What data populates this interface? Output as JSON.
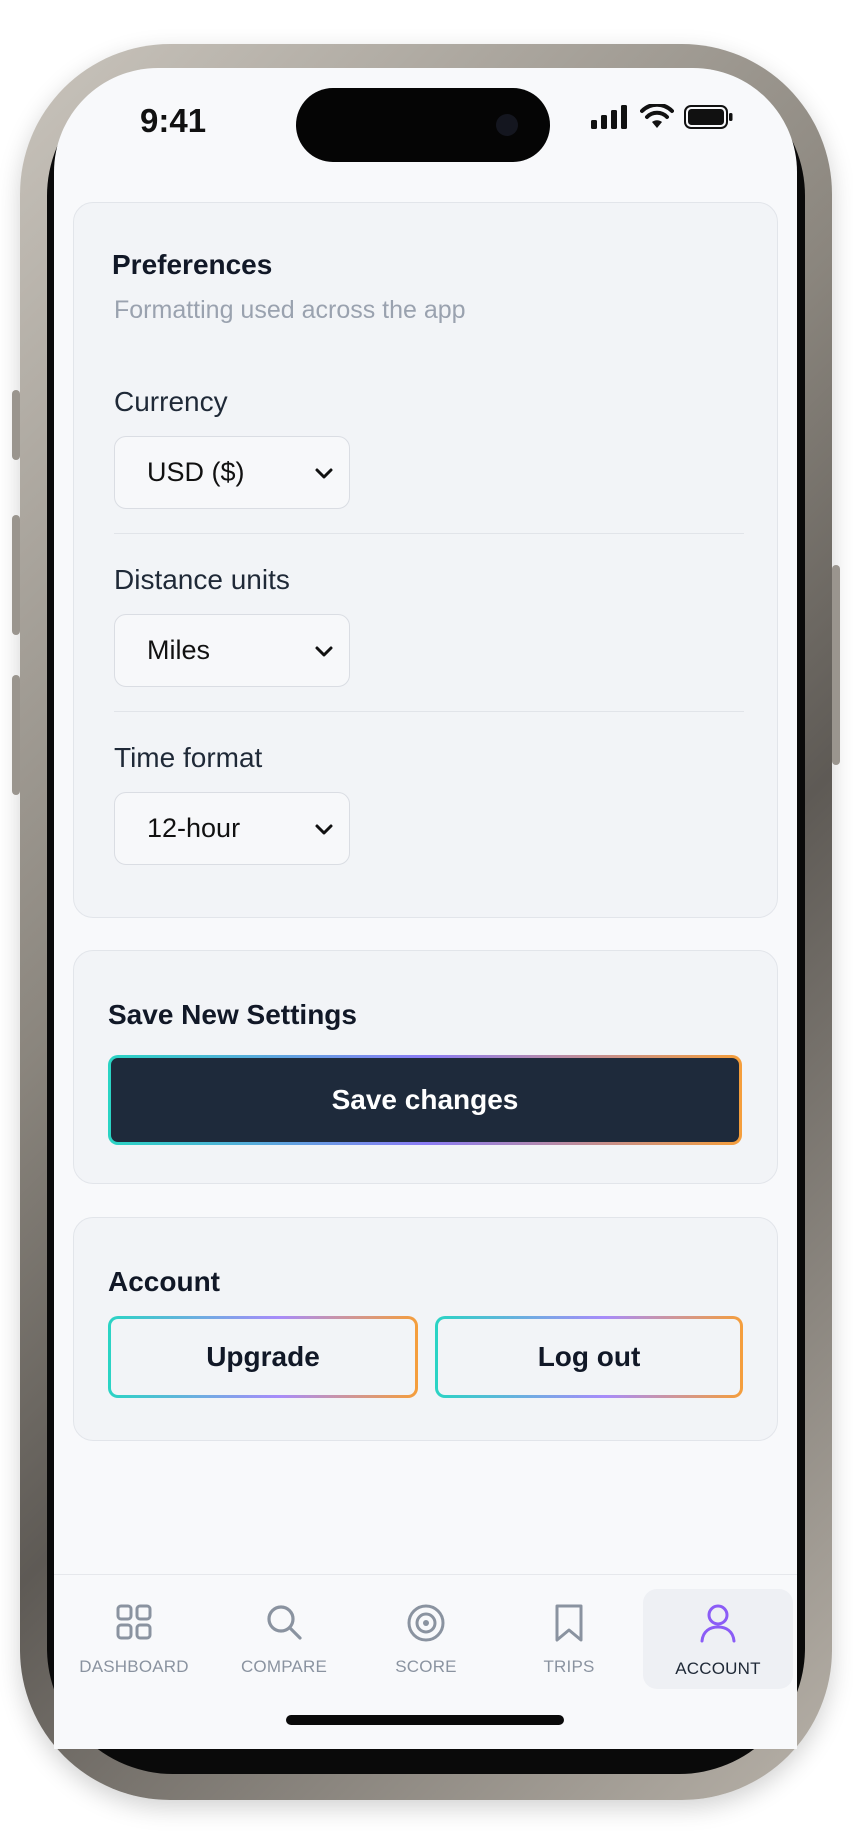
{
  "status_bar": {
    "time": "9:41"
  },
  "preferences": {
    "title": "Preferences",
    "subtitle": "Formatting used across the app",
    "currency": {
      "label": "Currency",
      "value": "USD ($)"
    },
    "distance": {
      "label": "Distance units",
      "value": "Miles"
    },
    "time_format": {
      "label": "Time format",
      "value": "12-hour"
    }
  },
  "save_section": {
    "title": "Save New Settings",
    "button": "Save changes"
  },
  "account": {
    "title": "Account",
    "upgrade": "Upgrade",
    "logout": "Log out"
  },
  "tabs": [
    {
      "label": "DASHBOARD",
      "icon": "grid-icon"
    },
    {
      "label": "COMPARE",
      "icon": "search-icon"
    },
    {
      "label": "SCORE",
      "icon": "target-icon"
    },
    {
      "label": "TRIPS",
      "icon": "bookmark-icon"
    },
    {
      "label": "ACCOUNT",
      "icon": "user-icon",
      "active": true
    }
  ],
  "colors": {
    "accent": "#8b5cf6",
    "button_dark": "#1e2a3b",
    "gradient": [
      "#2ad4c4",
      "#8b7cf5",
      "#f59e3b"
    ]
  }
}
